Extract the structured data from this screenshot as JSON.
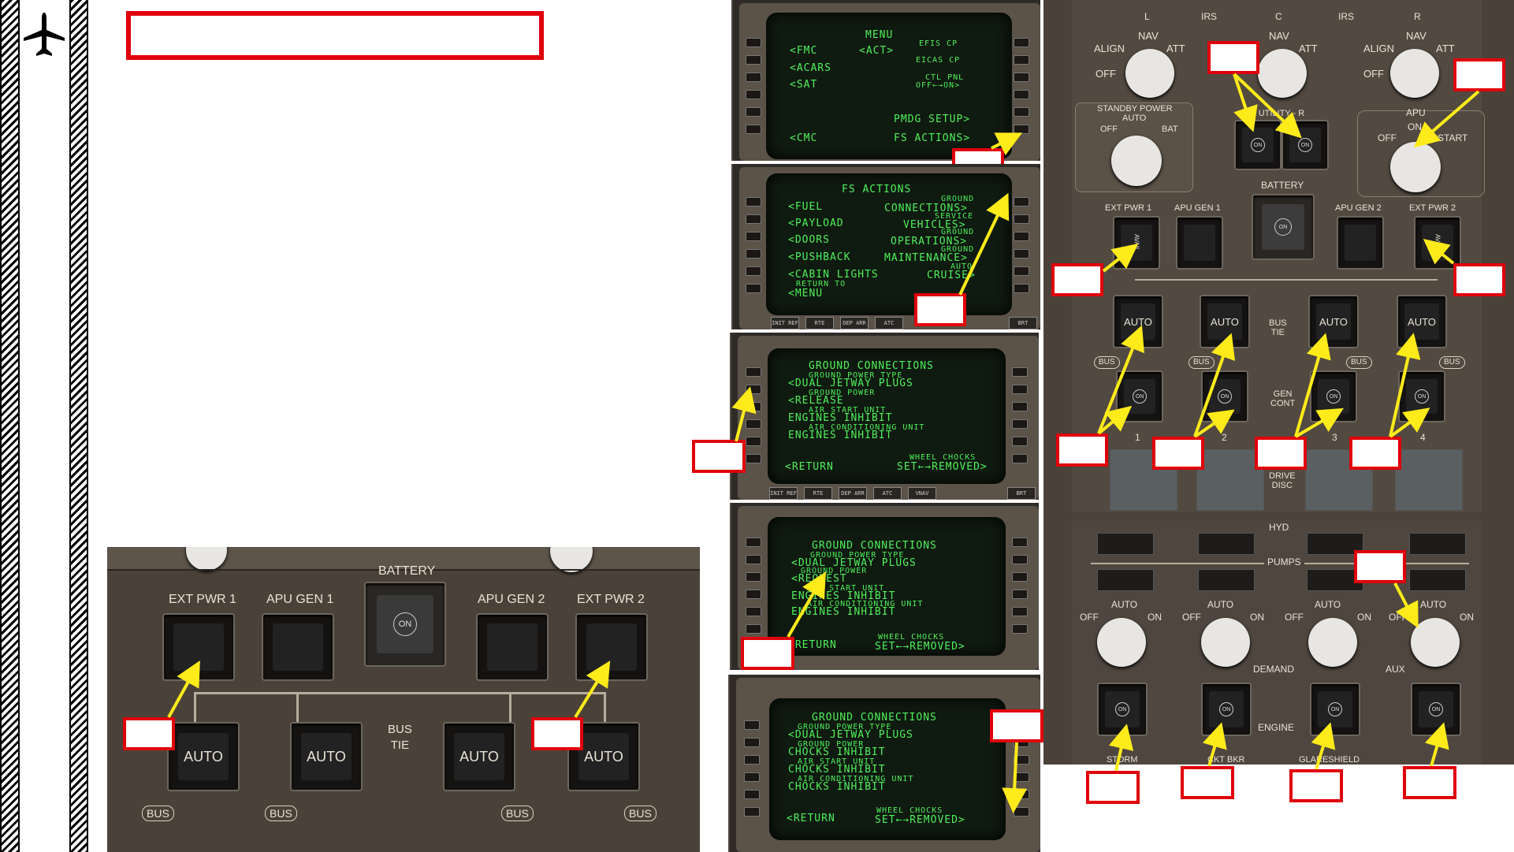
{
  "colors": {
    "callout": "#e0000b",
    "arrow": "#ffeb1a",
    "crt": "#4ff05a"
  },
  "icons": [
    "airplane-icon"
  ],
  "bottom_panel": {
    "battery": "BATTERY",
    "ext_pwr_1": "EXT PWR 1",
    "apu_gen_1": "APU GEN 1",
    "apu_gen_2": "APU GEN 2",
    "ext_pwr_2": "EXT PWR 2",
    "on": "ON",
    "auto": "AUTO",
    "bus_tie": "BUS\nTIE",
    "bus": "BUS"
  },
  "cdu1": {
    "title": "MENU",
    "left": [
      "<FMC",
      "<ACARS",
      "<SAT",
      "",
      "",
      "<CMC"
    ],
    "center_act": "<ACT>",
    "right": [
      "EFIS CP",
      "EICAS CP",
      "CTL PNL",
      "OFF←→ON>",
      "PMDG SETUP>",
      "FS ACTIONS>"
    ]
  },
  "cdu2": {
    "title": "FS ACTIONS",
    "left": [
      "<FUEL",
      "<PAYLOAD",
      "<DOORS",
      "<PUSHBACK",
      "<CABIN LIGHTS",
      "RETURN TO",
      "<MENU"
    ],
    "right_small": [
      "GROUND",
      "SERVICE",
      "GROUND",
      "GROUND",
      "AUTO"
    ],
    "right": [
      "CONNECTIONS>",
      "VEHICLES>",
      "OPERATIONS>",
      "MAINTENANCE>",
      "CRUISE>"
    ],
    "keys": [
      "INIT REF",
      "RTE",
      "DEP ARR",
      "ATC",
      "BRT"
    ]
  },
  "cdu3": {
    "title": "GROUND CONNECTIONS",
    "lines": [
      {
        "s": "GROUND POWER TYPE",
        "l": "<DUAL JETWAY PLUGS"
      },
      {
        "s": "GROUND POWER",
        "l": "<RELEASE"
      },
      {
        "s": "AIR START UNIT",
        "l": "ENGINES INHIBIT"
      },
      {
        "s": "AIR CONDITIONING UNIT",
        "l": "ENGINES INHIBIT"
      }
    ],
    "bottom_left": "<RETURN",
    "bottom_right_small": "WHEEL CHOCKS",
    "bottom_right": "SET←→REMOVED>",
    "keys": [
      "INIT REF",
      "RTE",
      "DEP ARR",
      "ATC",
      "VNAV",
      "BRT"
    ]
  },
  "cdu4": {
    "title": "GROUND CONNECTIONS",
    "lines": [
      {
        "s": "GROUND POWER TYPE",
        "l": "<DUAL JETWAY PLUGS"
      },
      {
        "s": "GROUND POWER",
        "l": "<REQUEST"
      },
      {
        "s": "AIR START UNIT",
        "l": "ENGINES INHIBIT"
      },
      {
        "s": "AIR CONDITIONING UNIT",
        "l": "ENGINES INHIBIT"
      }
    ],
    "bottom_left": "<RETURN",
    "bottom_right_small": "WHEEL CHOCKS",
    "bottom_right": "SET←→REMOVED>"
  },
  "cdu5": {
    "title": "GROUND CONNECTIONS",
    "lines": [
      {
        "s": "GROUND POWER TYPE",
        "l": "<DUAL JETWAY PLUGS"
      },
      {
        "s": "GROUND POWER",
        "l": "CHOCKS INHIBIT"
      },
      {
        "s": "AIR START UNIT",
        "l": "CHOCKS INHIBIT"
      },
      {
        "s": "AIR CONDITIONING UNIT",
        "l": "CHOCKS INHIBIT"
      }
    ],
    "bottom_left": "<RETURN",
    "bottom_right_small": "WHEEL CHOCKS",
    "bottom_right": "SET←→REMOVED>"
  },
  "overhead": {
    "irs_l": "L",
    "irs": "IRS",
    "irs_c": "C",
    "irs2": "IRS",
    "irs_r": "R",
    "nav": "NAV",
    "align": "ALIGN",
    "att": "ATT",
    "off": "OFF",
    "standby_power": "STANDBY POWER",
    "standby_auto": "AUTO",
    "standby_off": "OFF",
    "standby_bat": "BAT",
    "utility": "- UTILITY - R",
    "apu": "APU",
    "apu_on": "ON",
    "apu_off": "OFF",
    "apu_start": "START",
    "battery": "BATTERY",
    "ext_pwr_1": "EXT PWR 1",
    "apu_gen_1": "APU GEN 1",
    "apu_gen_2": "APU GEN 2",
    "ext_pwr_2": "EXT PWR 2",
    "avail": "AVAIL",
    "auto": "AUTO",
    "on": "ON",
    "bus": "BUS",
    "bus_tie": "BUS\nTIE",
    "gen_cont": "GEN\nCONT",
    "drive_disc": "DRIVE\nDISC",
    "gen_numbers": [
      "1",
      "2",
      "3",
      "4"
    ],
    "hyd": "HYD",
    "pumps": "PUMPS",
    "demand": "DEMAND",
    "aux": "AUX",
    "engine": "ENGINE",
    "storm": "STORM",
    "ckt_bkr": "CKT BKR",
    "glareshield": "GLARESHIELD"
  }
}
